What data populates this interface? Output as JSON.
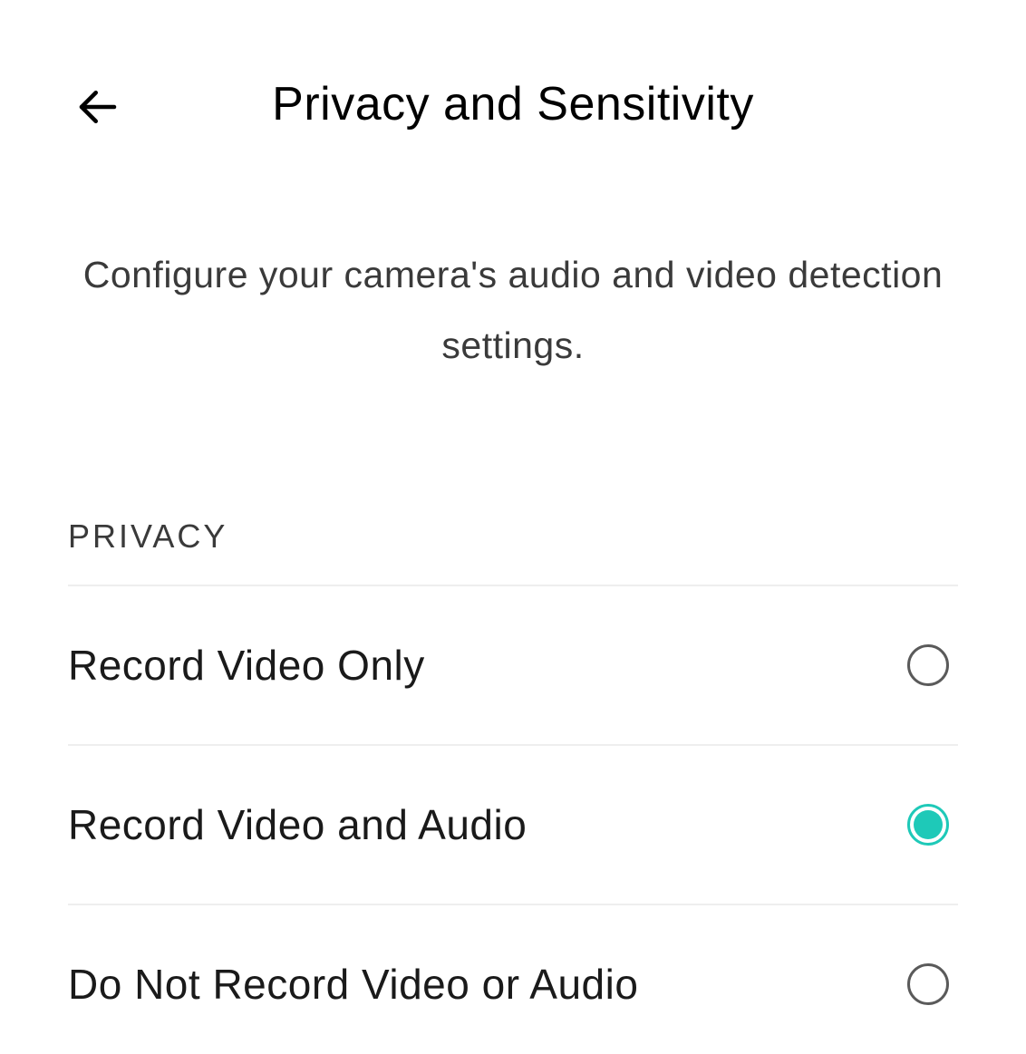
{
  "header": {
    "title": "Privacy and Sensitivity"
  },
  "description": "Configure your camera's audio and video detection settings.",
  "section": {
    "label": "PRIVACY",
    "options": [
      {
        "label": "Record Video Only",
        "selected": false
      },
      {
        "label": "Record Video and Audio",
        "selected": true
      },
      {
        "label": "Do Not Record Video or Audio",
        "selected": false
      }
    ]
  },
  "colors": {
    "accent": "#1ec9b8"
  }
}
